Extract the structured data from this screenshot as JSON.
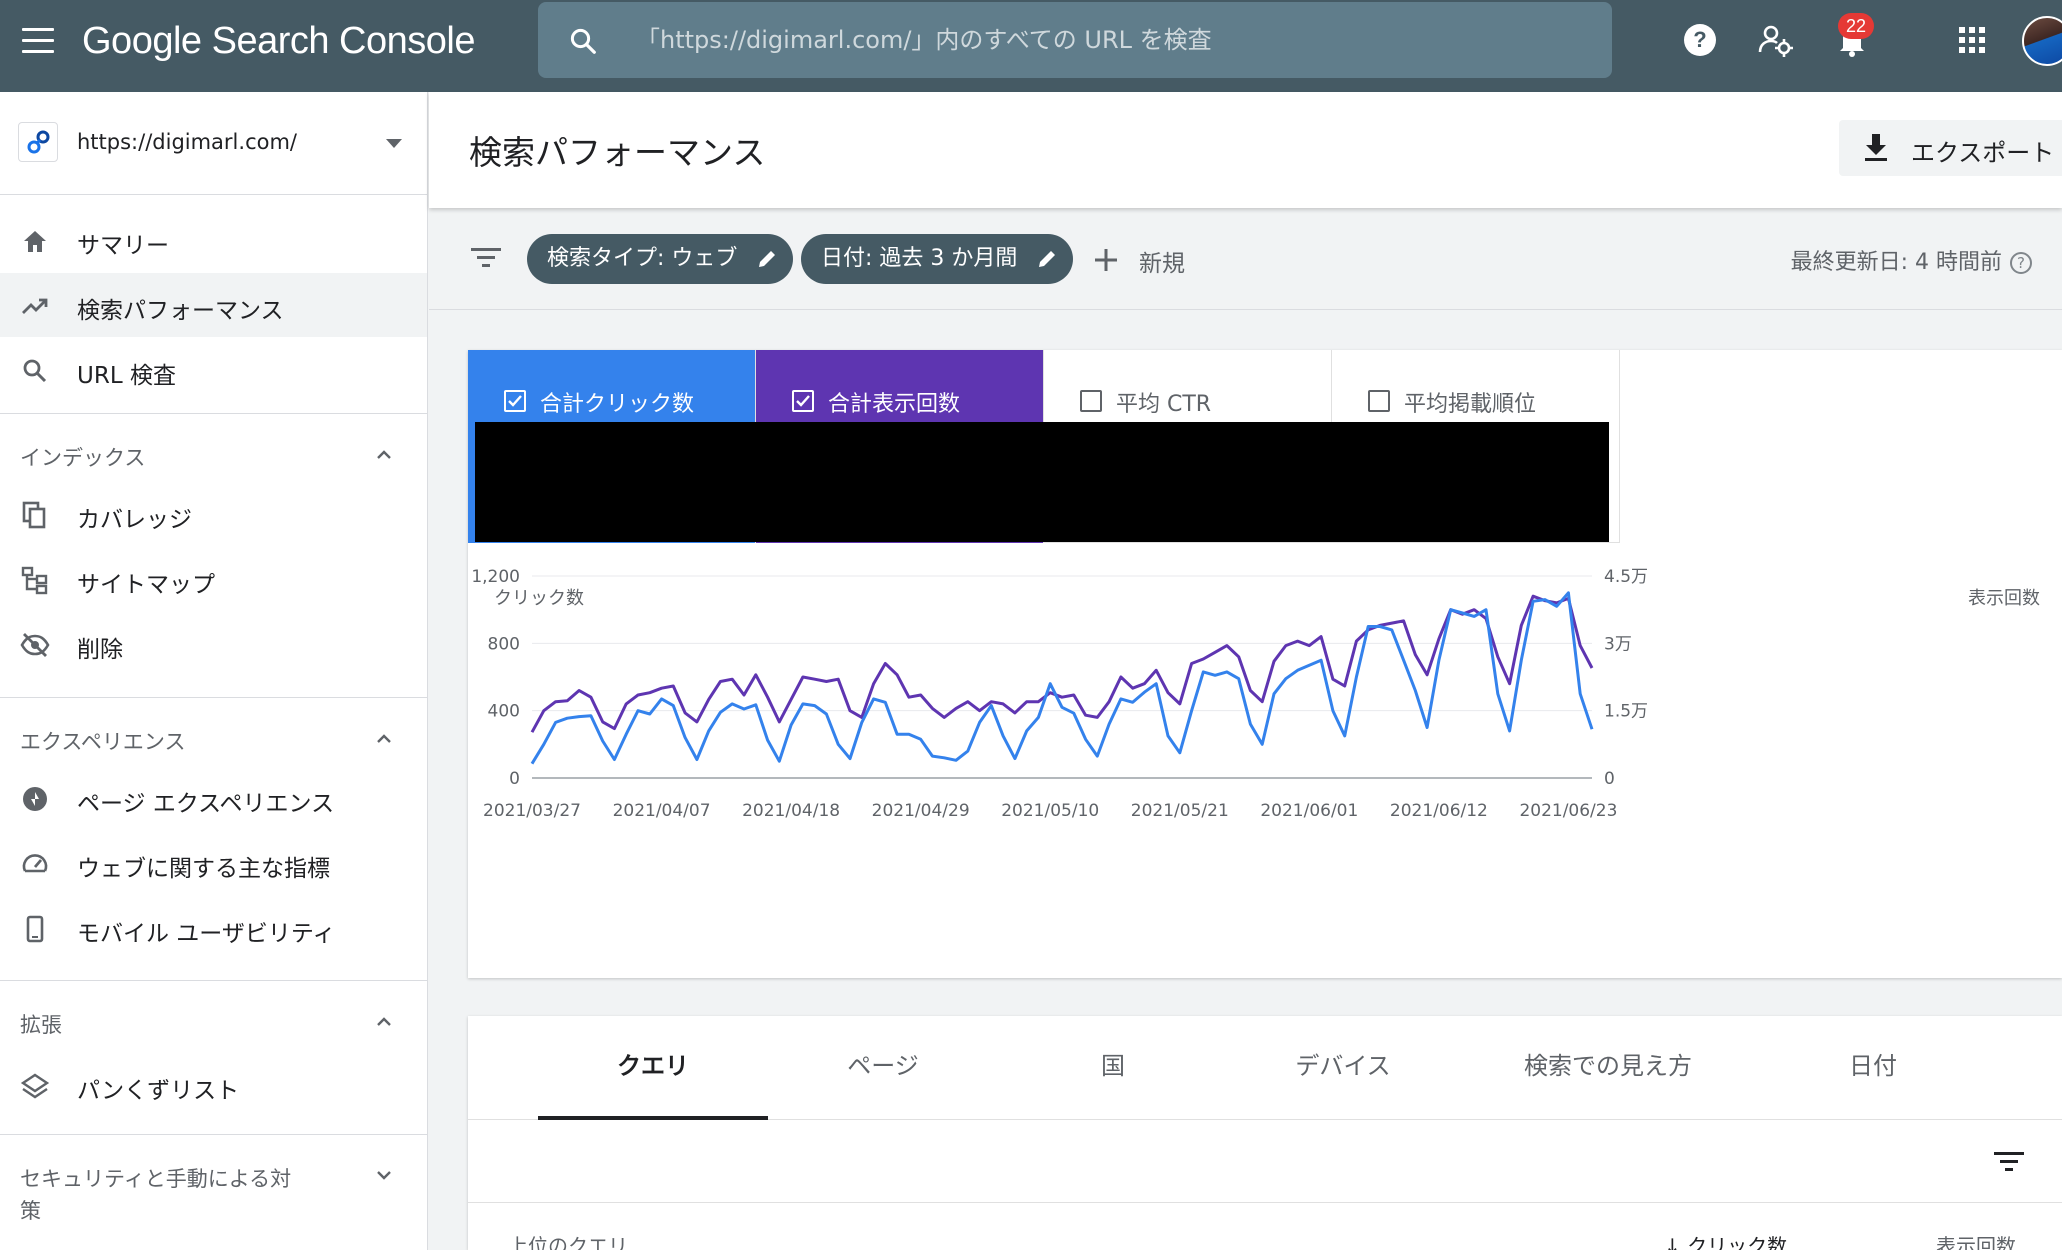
{
  "header": {
    "product_name": "Google Search Console",
    "search_placeholder": "「https://digimarl.com/」内のすべての URL を検査",
    "notification_count": "22"
  },
  "sidebar": {
    "property": "https://digimarl.com/",
    "items": {
      "summary": "サマリー",
      "performance": "検索パフォーマンス",
      "url_inspection": "URL 検査"
    },
    "sections": {
      "index": {
        "title": "インデックス",
        "items": [
          "カバレッジ",
          "サイトマップ",
          "削除"
        ]
      },
      "experience": {
        "title": "エクスペリエンス",
        "items": [
          "ページ エクスペリエンス",
          "ウェブに関する主な指標",
          "モバイル ユーザビリティ"
        ]
      },
      "enhancements": {
        "title": "拡張",
        "items": [
          "パンくずリスト"
        ]
      },
      "security": {
        "title_line1": "セキュリティと手動による対",
        "title_line2": "策"
      }
    }
  },
  "page": {
    "title": "検索パフォーマンス",
    "export_label": "エクスポート",
    "filters": {
      "search_type": "検索タイプ: ウェブ",
      "date": "日付: 過去 3 か月間",
      "new_label": "新規",
      "last_updated": "最終更新日: 4 時間前"
    }
  },
  "metrics": [
    {
      "label": "合計クリック数",
      "checked": true,
      "color": "#3482ec"
    },
    {
      "label": "合計表示回数",
      "checked": true,
      "color": "#5e35b1"
    },
    {
      "label": "平均 CTR",
      "checked": false,
      "color": "#ffffff"
    },
    {
      "label": "平均掲載順位",
      "checked": false,
      "color": "#ffffff"
    }
  ],
  "chart_data": {
    "type": "line",
    "ylabel_left": "クリック数",
    "ylabel_right": "表示回数",
    "y_left_ticks": [
      "1,200",
      "800",
      "400",
      "0"
    ],
    "y_right_ticks": [
      "4.5万",
      "3万",
      "1.5万",
      "0"
    ],
    "ylim_left": [
      0,
      1200
    ],
    "ylim_right": [
      0,
      45000
    ],
    "x_tick_labels": [
      "2021/03/27",
      "2021/04/07",
      "2021/04/18",
      "2021/04/29",
      "2021/05/10",
      "2021/05/21",
      "2021/06/01",
      "2021/06/12",
      "2021/06/23"
    ],
    "x_start": "2021-03-27",
    "x_end": "2021-06-25",
    "series": [
      {
        "name": "合計クリック数",
        "axis": "left",
        "color": "#3482ec",
        "values": [
          85,
          200,
          330,
          355,
          365,
          370,
          220,
          110,
          260,
          400,
          380,
          470,
          430,
          240,
          110,
          280,
          390,
          440,
          410,
          435,
          225,
          100,
          315,
          440,
          430,
          380,
          200,
          115,
          330,
          470,
          450,
          260,
          260,
          230,
          130,
          120,
          105,
          160,
          330,
          430,
          250,
          115,
          280,
          360,
          560,
          420,
          385,
          230,
          130,
          320,
          470,
          450,
          510,
          560,
          250,
          150,
          400,
          630,
          610,
          630,
          590,
          320,
          200,
          500,
          590,
          640,
          670,
          700,
          400,
          250,
          600,
          900,
          900,
          880,
          700,
          520,
          300,
          700,
          1000,
          980,
          960,
          1000,
          500,
          280,
          700,
          1050,
          1060,
          1020,
          1100,
          500,
          290
        ]
      },
      {
        "name": "合計表示回数",
        "axis": "right",
        "color": "#5e35b1",
        "values": [
          10200,
          15000,
          17000,
          17200,
          19500,
          18000,
          12500,
          11000,
          16500,
          18500,
          19000,
          20000,
          20500,
          14500,
          12500,
          17500,
          21500,
          22000,
          18500,
          23000,
          18000,
          12500,
          17500,
          22500,
          22000,
          21500,
          22000,
          15000,
          13500,
          21000,
          25500,
          23000,
          18000,
          18500,
          15500,
          13500,
          15500,
          17000,
          15000,
          17000,
          16500,
          14500,
          17000,
          17000,
          19000,
          18000,
          18500,
          14000,
          13500,
          17000,
          22500,
          20000,
          21000,
          24000,
          19000,
          16500,
          25500,
          26500,
          28000,
          29500,
          27000,
          19500,
          17000,
          26000,
          29500,
          30500,
          29500,
          31500,
          22000,
          20500,
          30500,
          33000,
          34000,
          34500,
          35000,
          27500,
          23000,
          31000,
          37500,
          36500,
          37500,
          35500,
          27000,
          21000,
          34000,
          40500,
          39500,
          39000,
          40000,
          29500,
          24500
        ]
      }
    ]
  },
  "table": {
    "tabs": [
      "クエリ",
      "ページ",
      "国",
      "デバイス",
      "検索での見え方",
      "日付"
    ],
    "columns": {
      "query": "上位のクエリ",
      "clicks": "クリック数",
      "impressions": "表示回数"
    }
  }
}
